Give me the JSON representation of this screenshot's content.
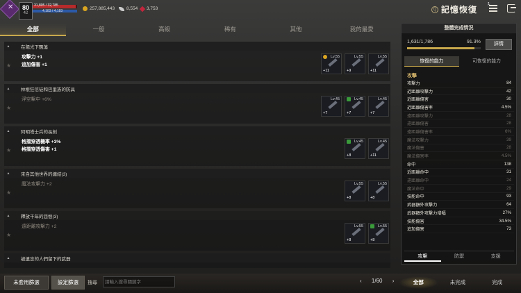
{
  "player": {
    "level": "80",
    "sub_level": "42",
    "hp_text": "31,805 / 32,785",
    "hp_fraction": 0.97,
    "mp_text": "4,183 / 4,183",
    "mp_fraction": 1.0
  },
  "currencies": {
    "gold": "257,885,443",
    "feather": "8,554",
    "ruby": "3,753"
  },
  "header": {
    "title": "記憶恢復",
    "notif_badge": "1"
  },
  "tabs": [
    "全部",
    "一般",
    "高級",
    "稀有",
    "其他",
    "我的最愛"
  ],
  "groups": [
    {
      "title": "在陽光下飄蕩",
      "stats": [
        {
          "text": "攻擊力 +1",
          "done": true
        },
        {
          "text": "追加傷害 +1",
          "done": true
        }
      ],
      "slots": [
        {
          "lv": "Lv.55",
          "plus": "+11",
          "mark": "gold"
        },
        {
          "lv": "Lv.55",
          "plus": "+9",
          "mark": ""
        },
        {
          "lv": "Lv.55",
          "plus": "+11",
          "mark": ""
        }
      ]
    },
    {
      "title": "林根狂信徒和巴里族的防具",
      "stats": [
        {
          "text": "浮空擊中 +6%",
          "done": false
        }
      ],
      "slots": [
        {
          "lv": "Lv.45",
          "plus": "+7",
          "mark": ""
        },
        {
          "lv": "Lv.45",
          "plus": "+7",
          "mark": "check"
        },
        {
          "lv": "Lv.45",
          "plus": "+7",
          "mark": ""
        }
      ]
    },
    {
      "title": "阿明塔士兵的長劍",
      "stats": [
        {
          "text": "格擋穿透機率 +3%",
          "done": true
        },
        {
          "text": "格擋穿透傷害 +1",
          "done": true
        }
      ],
      "slots": [
        {
          "lv": "Lv.45",
          "plus": "+8",
          "mark": "check"
        },
        {
          "lv": "Lv.45",
          "plus": "+11",
          "mark": ""
        }
      ]
    },
    {
      "title": "來自其他世界的纏結(3)",
      "stats": [
        {
          "text": "魔法攻擊力 +2",
          "done": false
        }
      ],
      "slots": [
        {
          "lv": "Lv.55",
          "plus": "+8",
          "mark": ""
        },
        {
          "lv": "Lv.55",
          "plus": "+8",
          "mark": ""
        }
      ]
    },
    {
      "title": "釋放千年的怨恨(3)",
      "stats": [
        {
          "text": "遠距離攻擊力 +2",
          "done": false
        }
      ],
      "slots": [
        {
          "lv": "Lv.55",
          "plus": "+8",
          "mark": ""
        },
        {
          "lv": "Lv.55",
          "plus": "+8",
          "mark": "check"
        }
      ]
    },
    {
      "title": "被遺忘的人們留下的武器",
      "stats": [],
      "slots": []
    }
  ],
  "panel": {
    "title": "整體完成情況",
    "count": "1,631/1,786",
    "percent": "91.3%",
    "progress": 0.913,
    "detail_btn": "詳情",
    "sub_tabs": [
      "恢復的能力",
      "可恢復的能力"
    ],
    "section_title": "攻擊",
    "abilities": [
      {
        "name": "攻擊力",
        "value": "84",
        "on": true
      },
      {
        "name": "近距離攻擊力",
        "value": "42",
        "on": true
      },
      {
        "name": "近距離傷害",
        "value": "30",
        "on": true
      },
      {
        "name": "近距離傷害率",
        "value": "4.5%",
        "on": true
      },
      {
        "name": "遠距離攻擊力",
        "value": "28",
        "on": false
      },
      {
        "name": "遠距離傷害",
        "value": "28",
        "on": false
      },
      {
        "name": "遠距離傷害率",
        "value": "6%",
        "on": false
      },
      {
        "name": "魔法攻擊力",
        "value": "39",
        "on": false
      },
      {
        "name": "魔法傷害",
        "value": "28",
        "on": false
      },
      {
        "name": "魔法傷害率",
        "value": "4.5%",
        "on": false
      },
      {
        "name": "命中",
        "value": "138",
        "on": true
      },
      {
        "name": "近距離命中",
        "value": "31",
        "on": true
      },
      {
        "name": "遠距離命中",
        "value": "24",
        "on": false
      },
      {
        "name": "魔法命中",
        "value": "29",
        "on": false
      },
      {
        "name": "技能命中",
        "value": "93",
        "on": true
      },
      {
        "name": "武器額外攻擊力",
        "value": "64",
        "on": true
      },
      {
        "name": "武器額外攻擊力增幅",
        "value": "27%",
        "on": true
      },
      {
        "name": "技能傷害",
        "value": "34.5%",
        "on": true
      },
      {
        "name": "追加傷害",
        "value": "73",
        "on": true
      }
    ],
    "bottom_tabs": [
      "攻擊",
      "防禦",
      "支援"
    ]
  },
  "bottom": {
    "unset_filter": "未套用篩選",
    "set_filter": "設定篩選",
    "search_label": "搜尋",
    "search_placeholder": "請輸入搜尋關鍵字",
    "page": "1/60",
    "filter_tabs": [
      "全部",
      "未完成",
      "完成"
    ]
  }
}
